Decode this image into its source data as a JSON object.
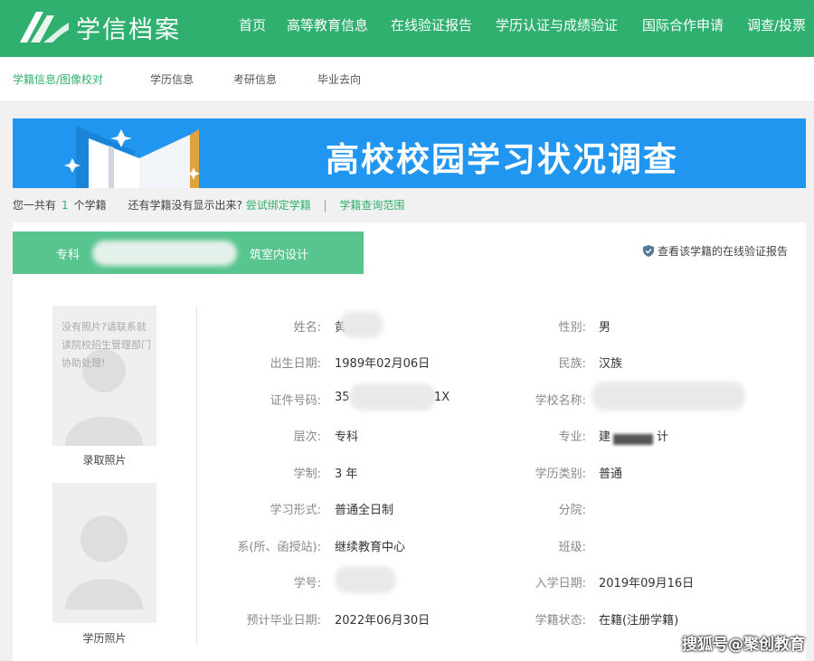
{
  "header": {
    "brand": "学信档案",
    "nav": [
      "首页",
      "高等教育信息",
      "在线验证报告",
      "学历认证与成绩验证",
      "国际合作申请",
      "调查/投票"
    ]
  },
  "subnav": [
    "学籍信息/图像校对",
    "学历信息",
    "考研信息",
    "毕业去向"
  ],
  "banner": {
    "title": "高校校园学习状况调查"
  },
  "summary": {
    "prefix": "您一共有",
    "count": "1",
    "suffix": "个学籍",
    "question": "还有学籍没有显示出来?",
    "bind_link": "尝试绑定学籍",
    "separator": "|",
    "scope_link": "学籍查询范围"
  },
  "record": {
    "tab_label": "专科",
    "tab_label_tail": "筑室内设计",
    "verify_link": "查看该学籍的在线验证报告"
  },
  "photos": {
    "note": "没有照片?请联系就读院校招生管理部门协助处理!",
    "admission_caption": "录取照片",
    "degree_caption": "学历照片"
  },
  "fields": {
    "name": {
      "label": "姓名:",
      "value": "黄"
    },
    "gender": {
      "label": "性别:",
      "value": "男"
    },
    "birth": {
      "label": "出生日期:",
      "value": "1989年02月06日"
    },
    "ethnicity": {
      "label": "民族:",
      "value": "汉族"
    },
    "id_number": {
      "label": "证件号码:",
      "value_start": "35",
      "value_end": "1X"
    },
    "school": {
      "label": "学校名称:",
      "value": ""
    },
    "level": {
      "label": "层次:",
      "value": "专科"
    },
    "major": {
      "label": "专业:",
      "value_start": "建",
      "value_end": "计"
    },
    "duration": {
      "label": "学制:",
      "value": "3 年"
    },
    "degree_type": {
      "label": "学历类别:",
      "value": "普通"
    },
    "study_form": {
      "label": "学习形式:",
      "value": "普通全日制"
    },
    "branch": {
      "label": "分院:",
      "value": ""
    },
    "department": {
      "label": "系(所、函授站):",
      "value": "继续教育中心"
    },
    "class": {
      "label": "班级:",
      "value": ""
    },
    "student_no": {
      "label": "学号:",
      "value": ""
    },
    "enroll_date": {
      "label": "入学日期:",
      "value": "2019年09月16日"
    },
    "grad_date": {
      "label": "预计毕业日期:",
      "value": "2022年06月30日"
    },
    "status": {
      "label": "学籍状态:",
      "value": "在籍(注册学籍)"
    }
  },
  "watermark": "搜狐号@聚创教育",
  "colors": {
    "brand_green": "#2fb06e",
    "tab_green": "#58c48e",
    "banner_blue": "#2196f0"
  }
}
